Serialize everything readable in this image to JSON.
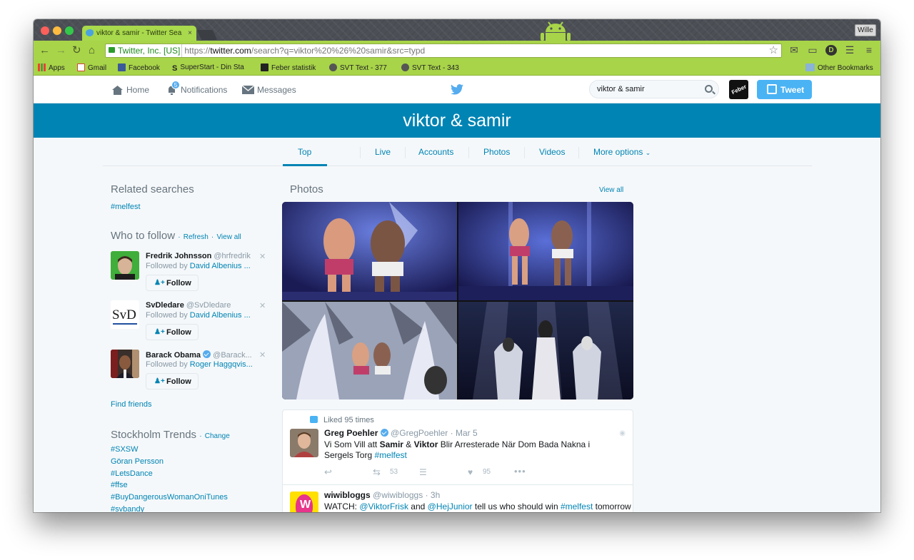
{
  "browser": {
    "tab_title": "viktor & samir - Twitter Sea",
    "tab_close": "×",
    "user_button": "Wille",
    "security_label": "Twitter, Inc. [US]",
    "url_scheme": "https://",
    "url_host": "twitter.com",
    "url_path": "/search?q=viktor%20%26%20samir&src=typd",
    "bookmarks": [
      {
        "label": "Apps",
        "icon": "apps-grid-icon"
      },
      {
        "label": "Gmail",
        "icon": "gmail-icon"
      },
      {
        "label": "Facebook",
        "icon": "facebook-icon"
      },
      {
        "label": "SuperStart - Din Sta",
        "icon": "superstart-icon"
      },
      {
        "label": "Feber statistik",
        "icon": "feber-icon"
      },
      {
        "label": "SVT Text - 377",
        "icon": "svt-gear-icon"
      },
      {
        "label": "SVT Text - 343",
        "icon": "svt-gear-icon"
      }
    ],
    "other_bookmarks": "Other Bookmarks"
  },
  "twitter": {
    "nav": {
      "home": "Home",
      "notifications": "Notifications",
      "notification_count": "5",
      "messages": "Messages",
      "search_value": "viktor & samir",
      "tweet_button": "Tweet",
      "feber_icon_text": "Feber"
    },
    "banner_title": "viktor & samir",
    "tabs": [
      "Top",
      "Live",
      "Accounts",
      "Photos",
      "Videos",
      "More options"
    ],
    "sidebar": {
      "related_title": "Related searches",
      "related": [
        "#melfest"
      ],
      "wtf_title": "Who to follow",
      "refresh": "Refresh",
      "view_all": "View all",
      "sep": "·",
      "follow_label": "Follow",
      "suggestions": [
        {
          "name": "Fredrik Johnsson",
          "handle": "@hrfredrik",
          "followed_prefix": "Followed by",
          "followed_by": "David Albenius ..."
        },
        {
          "name": "SvDledare",
          "handle": "@SvDledare",
          "followed_prefix": "Followed by",
          "followed_by": "David Albenius ..."
        },
        {
          "name": "Barack Obama",
          "handle": "@Barack...",
          "followed_prefix": "Followed by",
          "followed_by": "Roger Haggqvis..."
        }
      ],
      "svd_logo": "SvD",
      "find_friends": "Find friends",
      "trends_title": "Stockholm Trends",
      "trends_change": "Change",
      "trends": [
        "#SXSW",
        "Göran Persson",
        "#LetsDance",
        "#ffse",
        "#BuyDangerousWomanOniTunes",
        "#svbandy"
      ]
    },
    "photos": {
      "title": "Photos",
      "view_all": "View all"
    },
    "tweets": [
      {
        "context": "Liked 95 times",
        "name": "Greg Poehler",
        "handle": "@GregPoehler",
        "time": "· Mar 5",
        "text_parts": [
          "Vi Som Vill att ",
          "Samir",
          " & ",
          "Viktor",
          " Blir Arresterade När Dom Bada Nakna i Sergels Torg ",
          "#melfest"
        ],
        "retweets": "53",
        "likes": "95"
      },
      {
        "name": "wiwibloggs",
        "handle": "@wiwibloggs",
        "time": "· 3h",
        "text_parts": [
          "WATCH: ",
          "@ViktorFrisk",
          " and ",
          "@HejJunior",
          " tell us who should win ",
          "#melfest",
          " tomorrow"
        ]
      }
    ]
  },
  "colors": {
    "chrome_green": "#a8d449",
    "twitter_blue": "#0084b4",
    "tweet_button": "#4ab3f4"
  }
}
